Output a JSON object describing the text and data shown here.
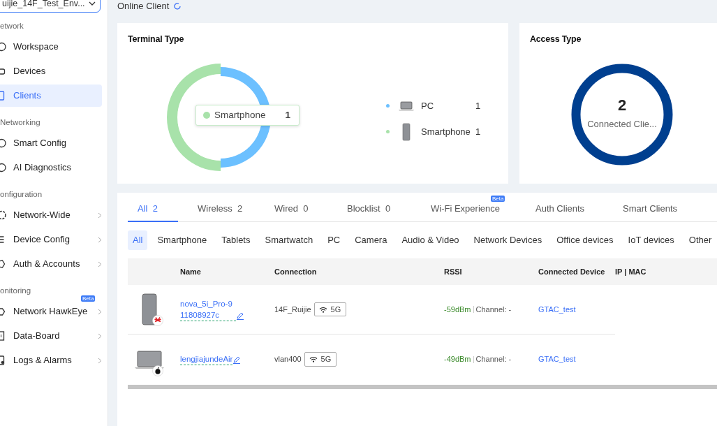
{
  "sidebar": {
    "site_select": "uijie_14F_Test_Env...",
    "sections": [
      {
        "title": "etwork",
        "items": [
          {
            "label": "Workspace",
            "selected": false,
            "expandable": false
          },
          {
            "label": "Devices",
            "selected": false,
            "expandable": false
          },
          {
            "label": "Clients",
            "selected": true,
            "expandable": false
          }
        ]
      },
      {
        "title": "Networking",
        "items": [
          {
            "label": "Smart Config",
            "selected": false,
            "expandable": false
          },
          {
            "label": "AI Diagnostics",
            "selected": false,
            "expandable": false
          }
        ]
      },
      {
        "title": "onfiguration",
        "items": [
          {
            "label": "Network-Wide",
            "selected": false,
            "expandable": true
          },
          {
            "label": "Device Config",
            "selected": false,
            "expandable": true
          },
          {
            "label": "Auth & Accounts",
            "selected": false,
            "expandable": true
          }
        ]
      },
      {
        "title": "onitoring",
        "items": [
          {
            "label": "Network HawkEye",
            "selected": false,
            "expandable": true,
            "badge": "Beta"
          },
          {
            "label": "Data-Board",
            "selected": false,
            "expandable": true
          },
          {
            "label": "Logs & Alarms",
            "selected": false,
            "expandable": true
          }
        ]
      }
    ]
  },
  "page_title": "Online Client",
  "terminal_type": {
    "title": "Terminal Type",
    "chart_data": {
      "type": "donut",
      "categories": [
        "PC",
        "Smartphone"
      ],
      "values": [
        50,
        50
      ]
    },
    "tooltip": {
      "label": "Smartphone",
      "value": "1",
      "color": "#a8e2aa"
    },
    "legend": [
      {
        "value": "1",
        "color": "#6cc0ff",
        "kind": "laptop"
      },
      {
        "value": "1",
        "color": "#a8e2aa",
        "kind": "phone"
      }
    ]
  },
  "access_type": {
    "title": "Access Type",
    "total": "2",
    "caption": "Connected Clie..."
  },
  "tabs": [
    {
      "label": "All",
      "count": "2",
      "selected": true
    },
    {
      "label": "Wireless",
      "count": "2",
      "selected": false
    },
    {
      "label": "Wired",
      "count": "0",
      "selected": false
    },
    {
      "label": "Blocklist",
      "count": "0",
      "selected": false
    },
    {
      "label": "Wi-Fi Experience",
      "badge": "Beta",
      "selected": false
    },
    {
      "label": "Auth Clients",
      "selected": false
    },
    {
      "label": "Smart Clients",
      "selected": false
    }
  ],
  "filters": [
    {
      "label": "All",
      "selected": true
    },
    {
      "label": "Smartphone",
      "selected": false
    },
    {
      "label": "Tablets",
      "selected": false
    },
    {
      "label": "Smartwatch",
      "selected": false
    },
    {
      "label": "PC",
      "selected": false
    },
    {
      "label": "Camera",
      "selected": false
    },
    {
      "label": "Audio & Video",
      "selected": false
    },
    {
      "label": "Network Devices",
      "selected": false
    },
    {
      "label": "Office devices",
      "selected": false
    },
    {
      "label": "IoT devices",
      "selected": false
    },
    {
      "label": "Other",
      "selected": false
    }
  ],
  "table": {
    "columns": [
      "Name",
      "Connection",
      "RSSI",
      "Connected Device",
      "IP | MAC"
    ],
    "rows": [
      {
        "kind": "phone",
        "name": "nova_5i_Pro-911808927c",
        "ssid": "14F_Ruijie",
        "band": "5G",
        "rssi": "-59dBm",
        "channel": "Channel: -",
        "device": "GTAC_test"
      },
      {
        "kind": "laptop",
        "name": "lengjiajundeAir",
        "ssid": "vlan400",
        "band": "5G",
        "rssi": "-49dBm",
        "channel": "Channel: -",
        "device": "GTAC_test"
      }
    ]
  }
}
